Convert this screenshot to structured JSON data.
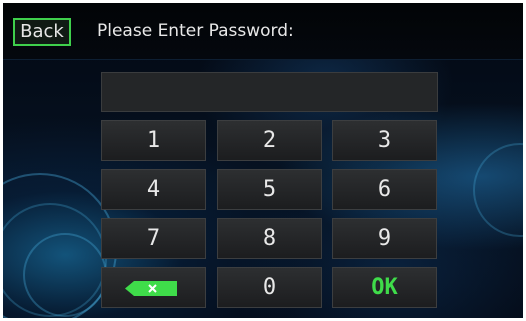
{
  "header": {
    "back_label": "Back",
    "title": "Please Enter Password:"
  },
  "password_field": {
    "value": ""
  },
  "keypad": {
    "keys": [
      "1",
      "2",
      "3",
      "4",
      "5",
      "6",
      "7",
      "8",
      "9",
      "0"
    ],
    "backspace_icon": "backspace-icon",
    "ok_label": "OK"
  },
  "colors": {
    "accent_green": "#3fdc4a",
    "key_background": "#242628",
    "screen_background": "#061222"
  }
}
